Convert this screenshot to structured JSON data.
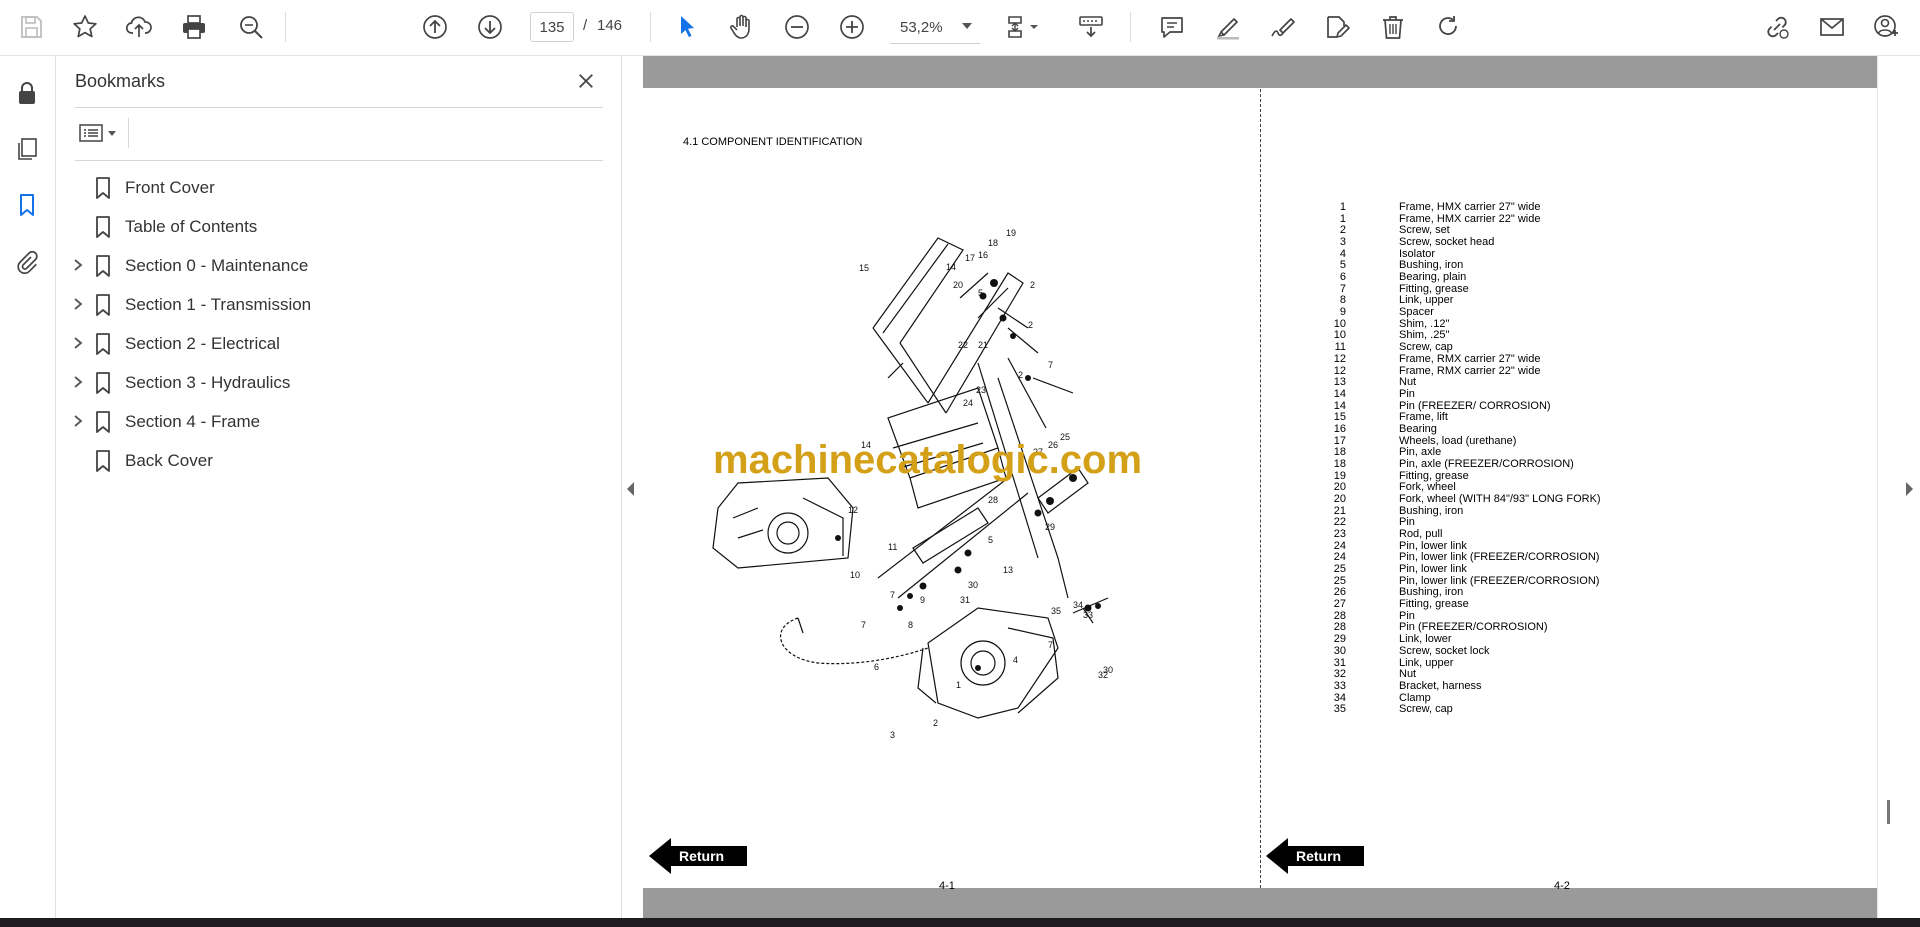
{
  "toolbar": {
    "current_page": "135",
    "page_separator": "/",
    "total_pages": "146",
    "zoom": "53,2%",
    "accent_color": "#1473e6"
  },
  "bookmarks_panel": {
    "title": "Bookmarks",
    "items": [
      {
        "label": "Front Cover",
        "expandable": false
      },
      {
        "label": "Table of Contents",
        "expandable": false
      },
      {
        "label": "Section 0 - Maintenance",
        "expandable": true
      },
      {
        "label": "Section 1 - Transmission",
        "expandable": true
      },
      {
        "label": "Section 2 - Electrical",
        "expandable": true
      },
      {
        "label": "Section 3 - Hydraulics",
        "expandable": true
      },
      {
        "label": "Section 4 - Frame",
        "expandable": true
      },
      {
        "label": "Back Cover",
        "expandable": false
      }
    ]
  },
  "document": {
    "left_page": {
      "heading": "4.1 COMPONENT IDENTIFICATION",
      "watermark": "machinecatalogic.com",
      "return_label": "Return",
      "page_number": "4-1"
    },
    "right_page": {
      "return_label": "Return",
      "page_number": "4-2",
      "parts": [
        {
          "no": "1",
          "desc": "Frame, HMX carrier 27\" wide"
        },
        {
          "no": "1",
          "desc": "Frame, HMX carrier 22\" wide"
        },
        {
          "no": "2",
          "desc": "Screw, set"
        },
        {
          "no": "3",
          "desc": "Screw, socket head"
        },
        {
          "no": "4",
          "desc": "Isolator"
        },
        {
          "no": "5",
          "desc": "Bushing, iron"
        },
        {
          "no": "6",
          "desc": "Bearing, plain"
        },
        {
          "no": "7",
          "desc": "Fitting, grease"
        },
        {
          "no": "8",
          "desc": "Link, upper"
        },
        {
          "no": "9",
          "desc": "Spacer"
        },
        {
          "no": "10",
          "desc": "Shim, .12\""
        },
        {
          "no": "10",
          "desc": "Shim, .25\""
        },
        {
          "no": "11",
          "desc": "Screw, cap"
        },
        {
          "no": "12",
          "desc": "Frame, RMX carrier 27\" wide"
        },
        {
          "no": "12",
          "desc": "Frame, RMX carrier 22\" wide"
        },
        {
          "no": "13",
          "desc": "Nut"
        },
        {
          "no": "14",
          "desc": "Pin"
        },
        {
          "no": "14",
          "desc": "Pin (FREEZER/ CORROSION)"
        },
        {
          "no": "15",
          "desc": "Frame, lift"
        },
        {
          "no": "16",
          "desc": "Bearing"
        },
        {
          "no": "17",
          "desc": "Wheels, load (urethane)"
        },
        {
          "no": "18",
          "desc": "Pin, axle"
        },
        {
          "no": "18",
          "desc": "Pin, axle (FREEZER/CORROSION)"
        },
        {
          "no": "19",
          "desc": "Fitting, grease"
        },
        {
          "no": "20",
          "desc": "Fork, wheel"
        },
        {
          "no": "20",
          "desc": "Fork, wheel (WITH 84\"/93\" LONG FORK)"
        },
        {
          "no": "21",
          "desc": "Bushing, iron"
        },
        {
          "no": "22",
          "desc": "Pin"
        },
        {
          "no": "23",
          "desc": "Rod, pull"
        },
        {
          "no": "24",
          "desc": "Pin, lower link"
        },
        {
          "no": "24",
          "desc": "Pin, lower link (FREEZER/CORROSION)"
        },
        {
          "no": "25",
          "desc": "Pin, lower link"
        },
        {
          "no": "25",
          "desc": "Pin, lower link  (FREEZER/CORROSION)"
        },
        {
          "no": "26",
          "desc": "Bushing, iron"
        },
        {
          "no": "27",
          "desc": "Fitting, grease"
        },
        {
          "no": "28",
          "desc": "Pin"
        },
        {
          "no": "28",
          "desc": "Pin  (FREEZER/CORROSION)"
        },
        {
          "no": "29",
          "desc": "Link, lower"
        },
        {
          "no": "30",
          "desc": "Screw, socket lock"
        },
        {
          "no": "31",
          "desc": "Link, upper"
        },
        {
          "no": "32",
          "desc": "Nut"
        },
        {
          "no": "33",
          "desc": "Bracket, harness"
        },
        {
          "no": "34",
          "desc": "Clamp"
        },
        {
          "no": "35",
          "desc": "Screw, cap"
        }
      ]
    },
    "diagram_callouts": [
      "1",
      "2",
      "2",
      "2",
      "2",
      "2",
      "3",
      "3",
      "4",
      "5",
      "5",
      "5",
      "5",
      "5",
      "6",
      "6",
      "7",
      "7",
      "7",
      "7",
      "7",
      "7",
      "7",
      "7",
      "7",
      "8",
      "9",
      "9",
      "10",
      "11",
      "12",
      "13",
      "14",
      "14",
      "15",
      "16",
      "17",
      "18",
      "19",
      "20",
      "21",
      "22",
      "23",
      "24",
      "25",
      "26",
      "27",
      "28",
      "29",
      "30",
      "30",
      "31",
      "32",
      "33",
      "34",
      "35"
    ]
  }
}
